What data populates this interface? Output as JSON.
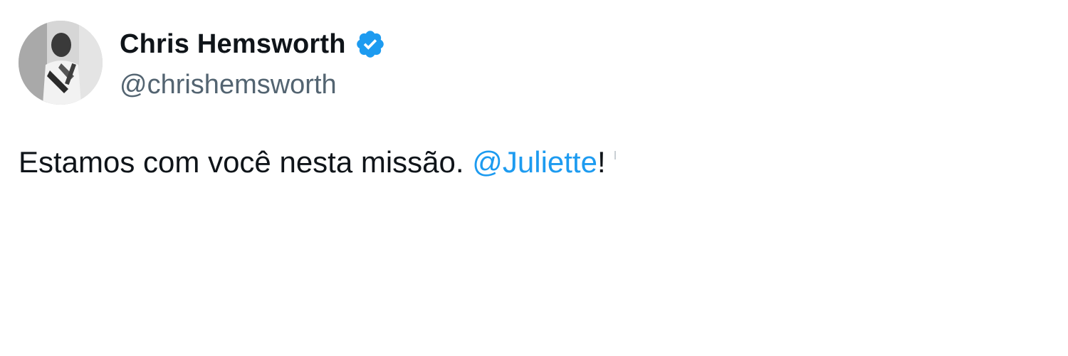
{
  "tweet": {
    "author": {
      "display_name": "Chris Hemsworth",
      "handle": "@chrishemsworth",
      "verified": true,
      "avatar_icon": "profile-photo",
      "verified_icon": "verified-badge-icon",
      "verified_color": "#1d9bf0"
    },
    "text_before_mention": "Estamos com você nesta missão. ",
    "mention": "@Juliette",
    "text_after_mention": "!",
    "colors": {
      "text": "#0f1419",
      "secondary": "#536471",
      "link": "#1d9bf0"
    }
  }
}
